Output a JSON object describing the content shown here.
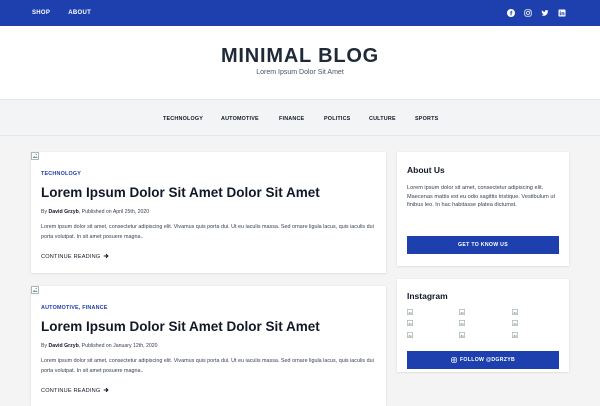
{
  "topbar": {
    "nav": [
      "SHOP",
      "ABOUT"
    ],
    "social_icons": [
      "facebook-icon",
      "instagram-icon",
      "twitter-icon",
      "linkedin-icon"
    ],
    "background": "#1e40af"
  },
  "header": {
    "title": "MINIMAL BLOG",
    "tagline": "Lorem Ipsum Dolor Sit Amet"
  },
  "categories": [
    "TECHNOLOGY",
    "AUTOMOTIVE",
    "FINANCE",
    "POLITICS",
    "CULTURE",
    "SPORTS"
  ],
  "posts": [
    {
      "categories": "TECHNOLOGY",
      "title": "Lorem Ipsum Dolor Sit Amet Dolor Sit Amet",
      "by": "By ",
      "author": "David Grzyb",
      "published": ", Published on April 25th, 2020",
      "excerpt": "Lorem ipsum dolor sit amet, consectetur adipiscing elit. Vivamus quis porta dui. Ut eu iaculis massa. Sed ornare ligula lacus, quis iaculis dui porta volutpat. In sit amet posuere magna..",
      "more": "CONTINUE READING"
    },
    {
      "categories": "AUTOMOTIVE, FINANCE",
      "title": "Lorem Ipsum Dolor Sit Amet Dolor Sit Amet",
      "by": "By ",
      "author": "David Grzyb",
      "published": ", Published on January 12th, 2020",
      "excerpt": "Lorem ipsum dolor sit amet, consectetur adipiscing elit. Vivamus quis porta dui. Ut eu iaculis massa. Sed ornare ligula lacus, quis iaculis dui porta volutpat. In sit amet posuere magna..",
      "more": "CONTINUE READING"
    }
  ],
  "sidebar": {
    "about": {
      "heading": "About Us",
      "text": "Lorem ipsum dolor sit amet, consectetur adipiscing elit. Maecenas mattis est eu odio sagittis tristique. Vestibulum ut finibus leo. In hac habitasse platea dictumst.",
      "button": "GET TO KNOW US"
    },
    "instagram": {
      "heading": "Instagram",
      "button": "FOLLOW @DGRZYB"
    }
  },
  "colors": {
    "accent": "#1e40af",
    "background": "#f4f4f5"
  }
}
